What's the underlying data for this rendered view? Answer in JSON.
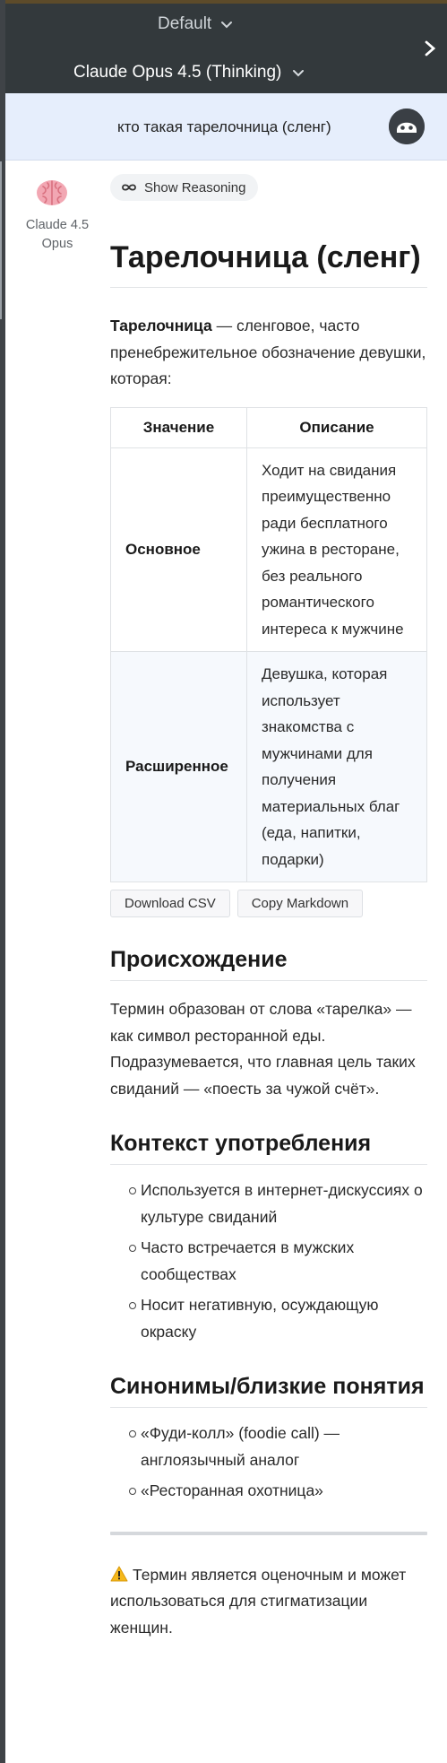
{
  "header": {
    "preset_label": "Default",
    "model_label": "Claude Opus 4.5 (Thinking)"
  },
  "prompt": {
    "text": "кто такая тарелочница (сленг)"
  },
  "assistant": {
    "name_line1": "Claude 4.5",
    "name_line2": "Opus",
    "show_reasoning_label": "Show Reasoning"
  },
  "answer": {
    "title": "Тарелочница (сленг)",
    "intro_term": "Тарелочница",
    "intro_rest": " — сленговое, часто пренебрежительное обозначение девушки, которая:",
    "table": {
      "headers": [
        "Значение",
        "Описание"
      ],
      "rows": [
        {
          "term": "Основное",
          "description": "Ходит на свидания преимущественно ради бесплатного ужина в ресторане, без реального романтического интереса к мужчине"
        },
        {
          "term": "Расширенное",
          "description": "Девушка, которая использует знакомства с мужчинами для получения материальных благ (еда, напитки, подарки)"
        }
      ],
      "download_csv_label": "Download CSV",
      "copy_markdown_label": "Copy Markdown"
    },
    "origin": {
      "heading": "Происхождение",
      "text": "Термин образован от слова «тарелка» — как символ ресторанной еды. Подразумевается, что главная цель таких свиданий — «поесть за чужой счёт»."
    },
    "context": {
      "heading": "Контекст употребления",
      "items": [
        "Используется в интернет-дискуссиях о культуре свиданий",
        "Часто встречается в мужских сообществах",
        "Носит негативную, осуждающую окраску"
      ]
    },
    "synonyms": {
      "heading": "Синонимы/близкие понятия",
      "items": [
        "«Фуди-колл» (foodie call) — англоязычный аналог",
        "«Ресторанная охотница»"
      ]
    },
    "warning": {
      "icon": "warning-icon",
      "text": "Термин является оценочным и может использоваться для стигматизации женщин."
    }
  }
}
